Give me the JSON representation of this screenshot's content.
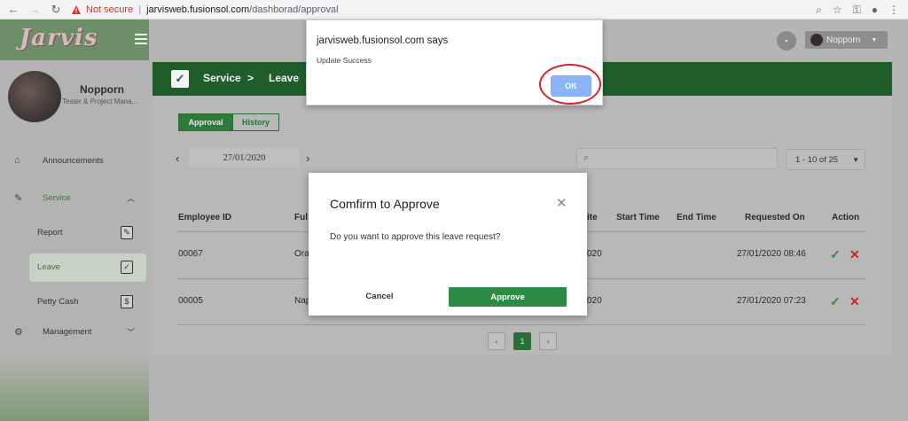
{
  "browser": {
    "not_secure": "Not secure",
    "separator": "|",
    "host": "jarvisweb.fusionsol.com",
    "path": "/dashborad/approval"
  },
  "app": {
    "logo": "Jarvis",
    "user_menu_label": "Nopporn"
  },
  "profile": {
    "name": "Nopporn",
    "role": "Tester & Project Mana..."
  },
  "sidebar": {
    "announcements": "Announcements",
    "service": "Service",
    "report": "Report",
    "leave": "Leave",
    "petty_cash": "Petty Cash",
    "management": "Management"
  },
  "header": {
    "crumb_service": "Service",
    "crumb_sep": ">",
    "crumb_leave": "Leave"
  },
  "tabs": {
    "approval": "Approval",
    "history": "History"
  },
  "date_nav": {
    "date": "27/01/2020"
  },
  "pager": {
    "range": "1 - 10 of 25",
    "pages": [
      "1"
    ]
  },
  "table": {
    "headers": {
      "employee_id": "Employee ID",
      "full": "Ful",
      "date": "ite",
      "start_time": "Start Time",
      "end_time": "End Time",
      "requested_on": "Requested On",
      "action": "Action"
    },
    "rows": [
      {
        "employee_id": "00067",
        "name": "Ora",
        "date": "020",
        "requested_on": "27/01/2020 08:46"
      },
      {
        "employee_id": "00005",
        "name": "Nap",
        "date": "020",
        "requested_on": "27/01/2020 07:23"
      }
    ]
  },
  "modal": {
    "title": "Comfirm to Approve",
    "message": "Do you want to approve this leave request?",
    "cancel": "Cancel",
    "approve": "Approve"
  },
  "alert": {
    "title": "jarvisweb.fusionsol.com says",
    "message": "Update Success",
    "ok": "OK"
  },
  "colors": {
    "brand_green": "#1f5e2a",
    "approve_green": "#2e8b45",
    "reject_red": "#c62828",
    "highlight_ring": "#d8232a",
    "alert_ok_blue": "#8ab4f8"
  }
}
